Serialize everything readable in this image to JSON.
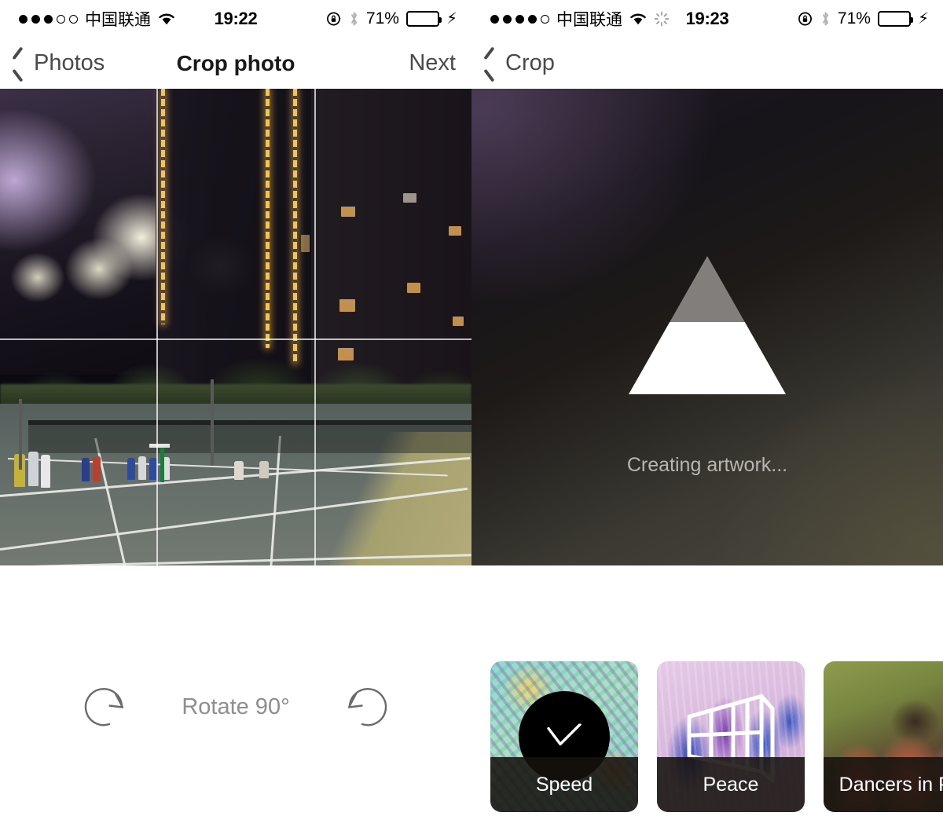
{
  "left_phone": {
    "status_bar": {
      "signal_dots_filled": 3,
      "signal_dots_total": 5,
      "carrier": "中国联通",
      "wifi_icon": "wifi-icon",
      "time": "19:22",
      "rotation_lock_icon": "rotation-lock-icon",
      "bluetooth_icon": "bluetooth-icon",
      "battery_percent": "71%",
      "battery_level": 71,
      "battery_color": "#4cd964",
      "charging_icon": "lightning-bolt-icon"
    },
    "nav_bar": {
      "back_icon": "chevron-left-icon",
      "back_label": "Photos",
      "title": "Crop photo",
      "action_label": "Next"
    },
    "photo": {
      "description": "night tennis court",
      "crop_grid": "rule-of-thirds"
    },
    "controls": {
      "rotate_ccw_icon": "rotate-clockwise-icon",
      "rotate_label": "Rotate 90°",
      "rotate_cw_icon": "rotate-counterclockwise-icon"
    }
  },
  "right_phone": {
    "status_bar": {
      "signal_dots_filled": 4,
      "signal_dots_total": 5,
      "carrier": "中国联通",
      "wifi_icon": "wifi-icon",
      "activity_icon": "network-activity-spinner-icon",
      "time": "19:23",
      "rotation_lock_icon": "rotation-lock-icon",
      "bluetooth_icon": "bluetooth-icon",
      "battery_percent": "71%",
      "battery_level": 71,
      "battery_color": "#4cd964",
      "charging_icon": "lightning-bolt-icon"
    },
    "nav_bar": {
      "back_icon": "chevron-left-icon",
      "back_label": "Crop"
    },
    "processing": {
      "logo_icon": "prisma-triangle-progress-icon",
      "progress_percent": 52,
      "status_text": "Creating artwork..."
    },
    "filters": [
      {
        "name": "Speed",
        "selected": true,
        "check_icon": "checkmark-icon"
      },
      {
        "name": "Peace",
        "selected": false,
        "overlay_icon": "wireframe-glyph-icon"
      },
      {
        "name": "Dancers in Pi",
        "selected": false
      }
    ]
  }
}
